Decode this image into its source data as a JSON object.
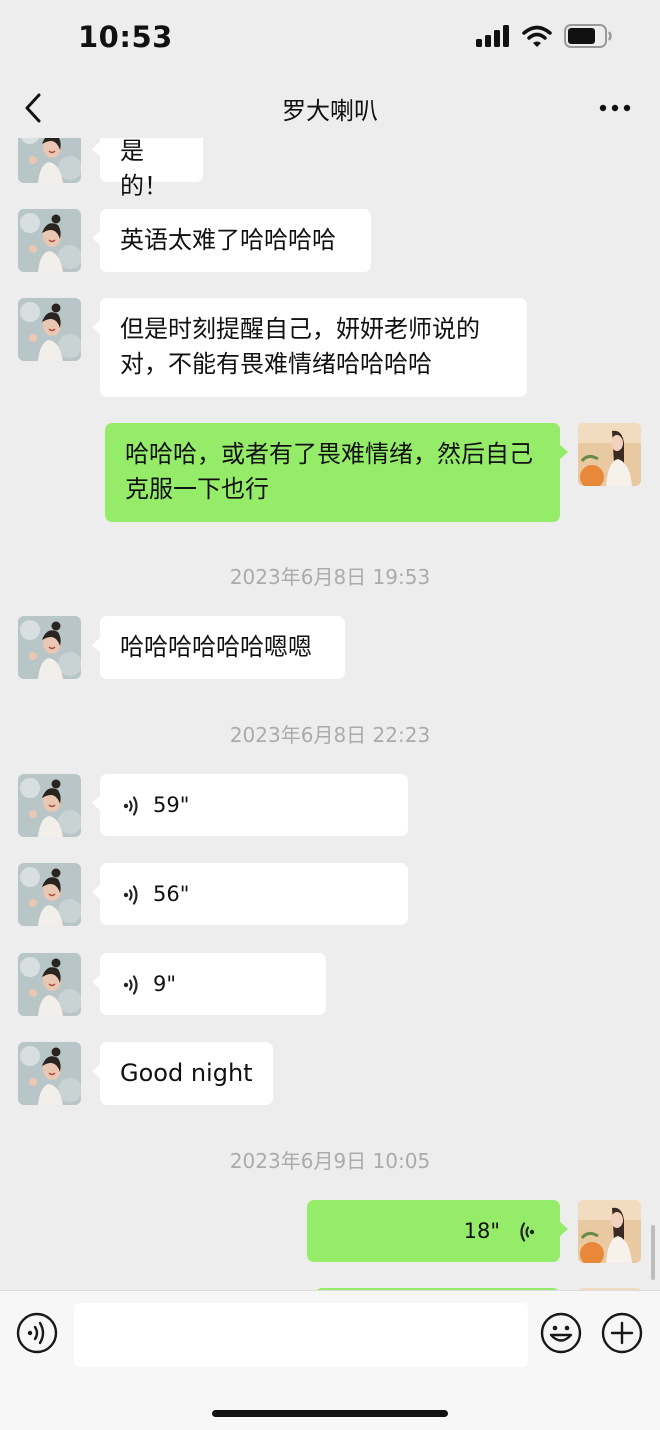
{
  "status_bar": {
    "time": "10:53",
    "battery_level": 0.75
  },
  "nav": {
    "title": "罗大喇叭",
    "back_icon": "chevron-left-icon",
    "more_icon": "more-dots-icon"
  },
  "messages": [
    {
      "type": "text",
      "side": "left",
      "text": "是的！"
    },
    {
      "type": "text",
      "side": "left",
      "text": "英语太难了哈哈哈哈"
    },
    {
      "type": "text",
      "side": "left",
      "text": "但是时刻提醒自己，妍妍老师说的对，不能有畏难情绪哈哈哈哈"
    },
    {
      "type": "text",
      "side": "right",
      "text": "哈哈哈，或者有了畏难情绪，然后自己克服一下也行"
    },
    {
      "type": "timestamp",
      "text": "2023年6月8日 19:53"
    },
    {
      "type": "text",
      "side": "left",
      "text": "哈哈哈哈哈哈嗯嗯"
    },
    {
      "type": "timestamp",
      "text": "2023年6月8日 22:23"
    },
    {
      "type": "voice",
      "side": "left",
      "duration": "59\""
    },
    {
      "type": "voice",
      "side": "left",
      "duration": "56\""
    },
    {
      "type": "voice",
      "side": "left",
      "duration": "9\""
    },
    {
      "type": "text",
      "side": "left",
      "text": "Good night"
    },
    {
      "type": "timestamp",
      "text": "2023年6月9日 10:05"
    },
    {
      "type": "voice",
      "side": "right",
      "duration": "18\""
    }
  ],
  "input_bar": {
    "voice_icon": "voice-toggle-icon",
    "emoji_icon": "emoji-icon",
    "plus_icon": "plus-icon",
    "input_value": ""
  },
  "colors": {
    "background": "#ededed",
    "incoming_bubble": "#ffffff",
    "outgoing_bubble": "#95ec69",
    "timestamp_text": "#ababab"
  }
}
